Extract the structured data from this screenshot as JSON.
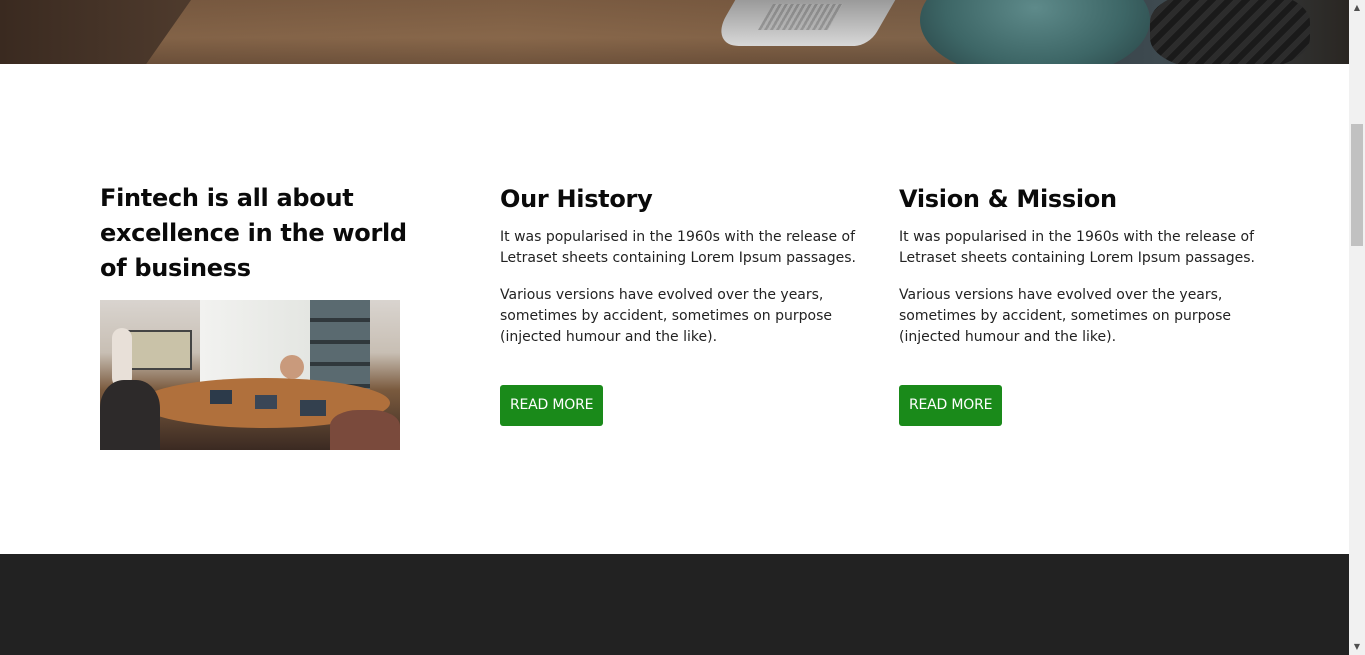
{
  "hero": {
    "image_alt": "Team working around a meeting table with laptops"
  },
  "intro": {
    "heading": "Fintech is all about excellence in the world of business",
    "image_alt": "Business meeting in a conference room"
  },
  "history": {
    "heading": "Our History",
    "paragraph_1": "It was popularised in the 1960s with the release of Letraset sheets containing Lorem Ipsum passages.",
    "paragraph_2": "Various versions have evolved over the years, sometimes by accident, sometimes on purpose (injected humour and the like).",
    "button_label": "READ MORE"
  },
  "vision": {
    "heading": "Vision & Mission",
    "paragraph_1": "It was popularised in the 1960s with the release of Letraset sheets containing Lorem Ipsum passages.",
    "paragraph_2": "Various versions have evolved over the years, sometimes by accident, sometimes on purpose (injected humour and the like).",
    "button_label": "READ MORE"
  },
  "scrollbar": {
    "up_icon": "triangle-up",
    "down_icon": "triangle-down"
  },
  "colors": {
    "accent": "#1a8a1a",
    "footer": "#222222",
    "text": "#0a0a0a"
  }
}
